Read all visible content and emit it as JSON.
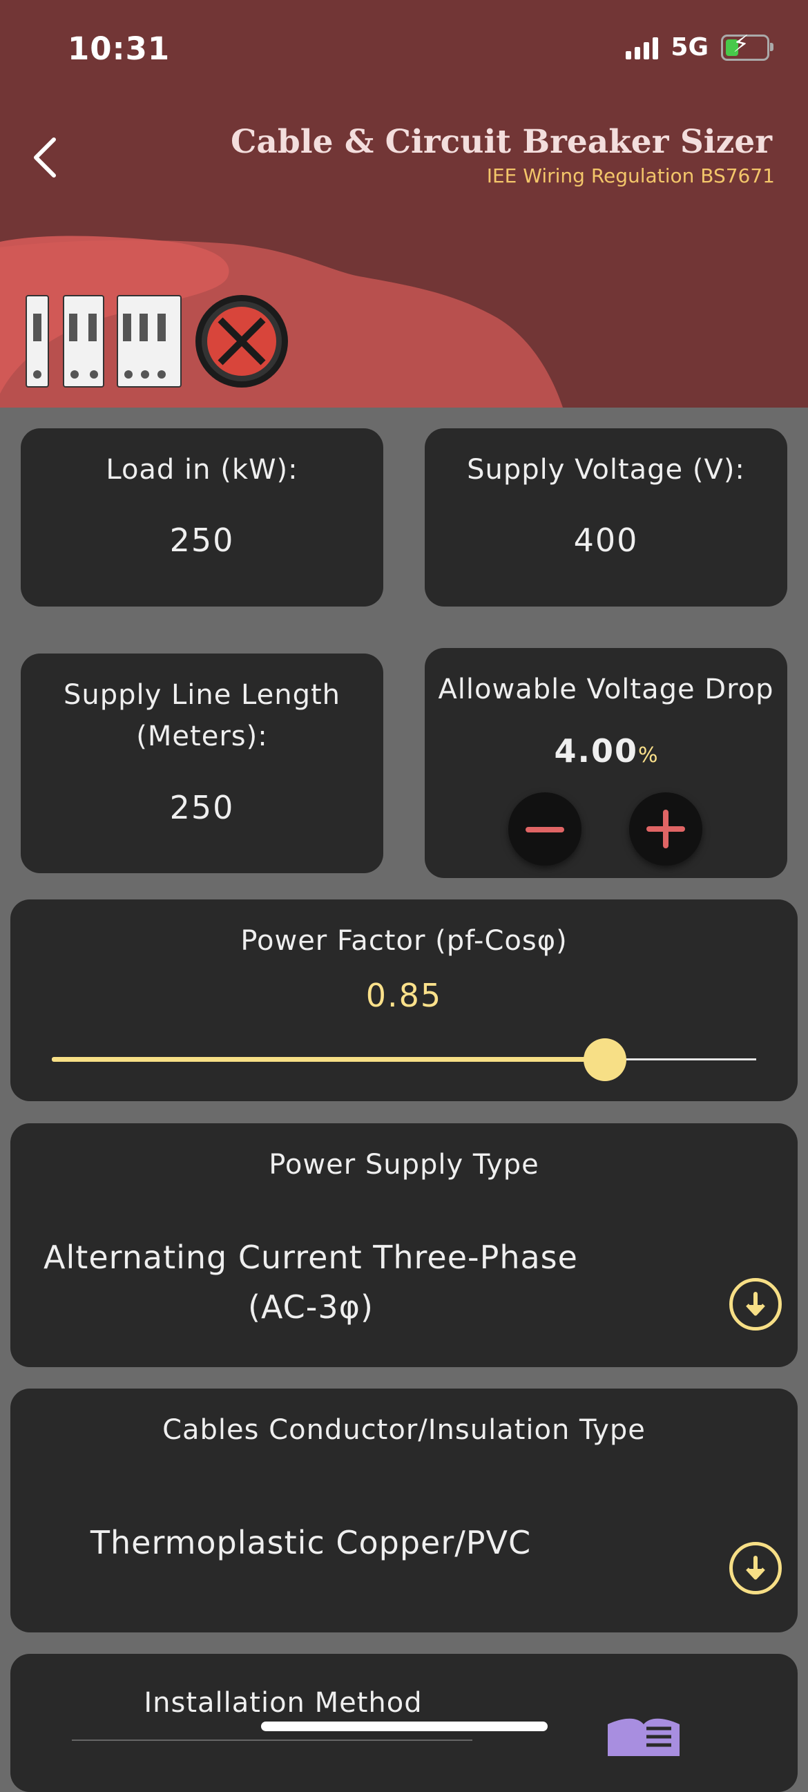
{
  "status_bar": {
    "time": "10:31",
    "network": "5G"
  },
  "header": {
    "title": "Cable & Circuit Breaker Sizer",
    "subtitle": "IEE Wiring Regulation BS7671",
    "back_icon": "chevron-left-icon",
    "images": [
      "circuit-breakers-icon",
      "cable-cross-section-icon"
    ]
  },
  "inputs": {
    "load": {
      "label": "Load in (kW):",
      "value": "250"
    },
    "voltage": {
      "label": "Supply Voltage (V):",
      "value": "400"
    },
    "length": {
      "label": "Supply Line Length (Meters):",
      "value": "250"
    },
    "voltage_drop": {
      "label": "Allowable Voltage Drop",
      "value": "4.00",
      "unit": "%"
    }
  },
  "power_factor": {
    "label": "Power Factor (pf-Cosφ)",
    "value": "0.85",
    "slider_fraction": 0.85
  },
  "supply_type": {
    "label": "Power Supply Type",
    "value_line1": "Alternating Current Three-Phase",
    "value_line2": "(AC-3φ)"
  },
  "conductor": {
    "label": "Cables Conductor/Insulation Type",
    "value": "Thermoplastic Copper/PVC"
  },
  "installation": {
    "label": "Installation Method"
  },
  "colors": {
    "header_bg": "#723636",
    "card_bg": "#292929",
    "accent_yellow": "#f7df86",
    "accent_red": "#e06565",
    "page_bg": "#6b6b6b"
  }
}
